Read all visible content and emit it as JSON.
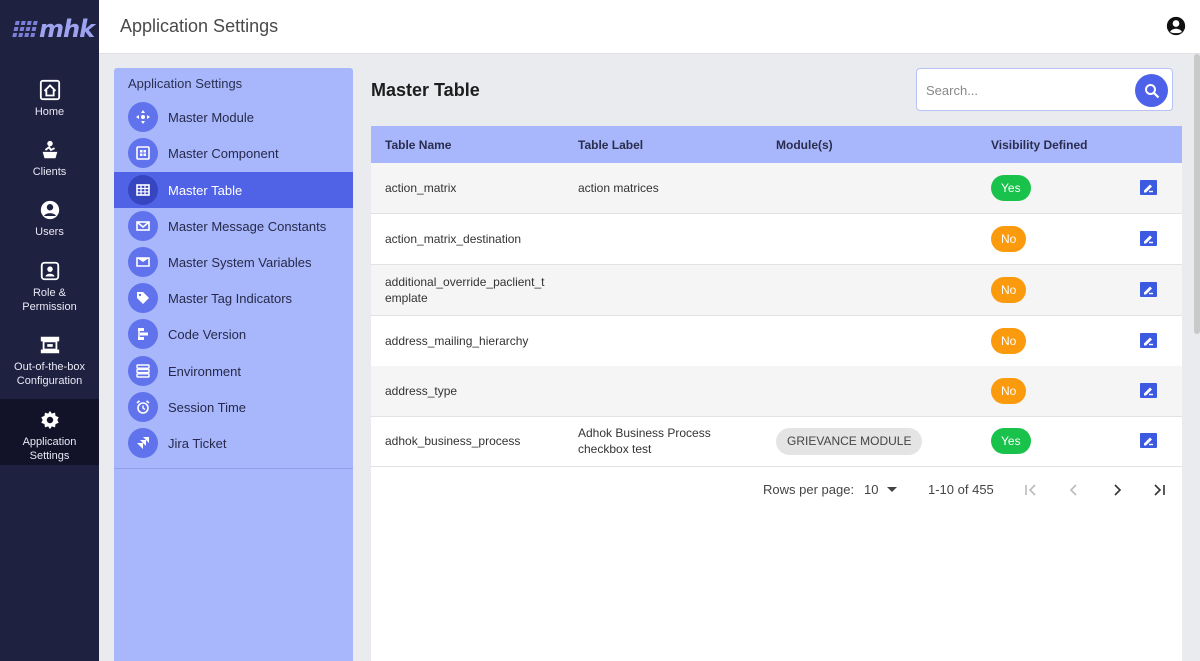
{
  "logo": {
    "text": "mhk"
  },
  "nav": [
    {
      "label": "Home",
      "icon": "home-icon"
    },
    {
      "label": "Clients",
      "icon": "clients-icon"
    },
    {
      "label": "Users",
      "icon": "user-icon"
    },
    {
      "label": "Role &\nPermission",
      "icon": "role-permission-icon"
    },
    {
      "label": "Out-of-the-box\nConfiguration",
      "icon": "configuration-icon"
    },
    {
      "label": "Application\nSettings",
      "icon": "gear-icon",
      "active": true
    }
  ],
  "header": {
    "title": "Application Settings",
    "account_icon": "account-circle-icon"
  },
  "submenu": {
    "title": "Application Settings",
    "items": [
      {
        "label": "Master Module",
        "icon": "module-icon"
      },
      {
        "label": "Master Component",
        "icon": "component-icon"
      },
      {
        "label": "Master Table",
        "icon": "table-icon",
        "active": true
      },
      {
        "label": "Master Message Constants",
        "icon": "mail-icon"
      },
      {
        "label": "Master System Variables",
        "icon": "variables-icon"
      },
      {
        "label": "Master Tag Indicators",
        "icon": "tag-icon"
      },
      {
        "label": "Code Version",
        "icon": "code-version-icon"
      },
      {
        "label": "Environment",
        "icon": "environment-icon"
      },
      {
        "label": "Session Time",
        "icon": "alarm-icon"
      },
      {
        "label": "Jira Ticket",
        "icon": "jira-icon"
      }
    ]
  },
  "main": {
    "title": "Master Table",
    "search": {
      "placeholder": "Search...",
      "value": ""
    },
    "table": {
      "columns": [
        "Table Name",
        "Table Label",
        "Module(s)",
        "Visibility Defined"
      ],
      "rows": [
        {
          "name": "action_matrix",
          "label": "action matrices",
          "module": "",
          "visibility": "Yes"
        },
        {
          "name": "action_matrix_destination",
          "label": "",
          "module": "",
          "visibility": "No"
        },
        {
          "name": "additional_override_paclient_t\nemplate",
          "label": "",
          "module": "",
          "visibility": "No"
        },
        {
          "name": "address_mailing_hierarchy",
          "label": "",
          "module": "",
          "visibility": "No"
        },
        {
          "name": "address_type",
          "label": "",
          "module": "",
          "visibility": "No"
        },
        {
          "name": "adhok_business_process",
          "label": "Adhok Business Process\ncheckbox test",
          "module": "GRIEVANCE MODULE",
          "visibility": "Yes"
        }
      ]
    },
    "pagination": {
      "rows_per_page_label": "Rows per page:",
      "rows_per_page": "10",
      "range": "1-10 of 455"
    }
  },
  "colors": {
    "rail": "#1f2140",
    "accent": "#5062e6",
    "submenu_bg": "#a8b7fb",
    "yes": "#19c34b",
    "no": "#fb9a0c"
  }
}
